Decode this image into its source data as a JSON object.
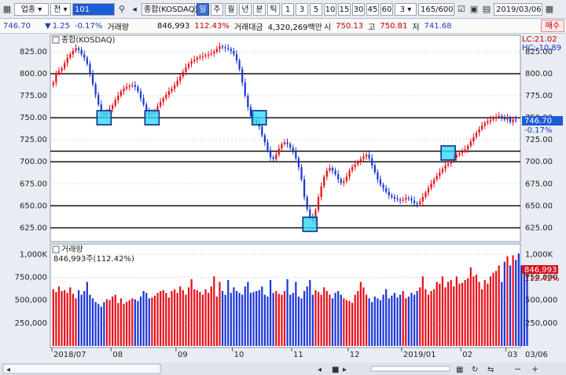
{
  "toolbar": {
    "sector_select": "업종",
    "field_label": "전",
    "code": "101",
    "name": "종합(KOSDAQ)",
    "periods": [
      "주",
      "월",
      "년",
      "분",
      "틱"
    ],
    "minute_steps": [
      "1",
      "3",
      "5",
      "10",
      "15",
      "30",
      "45",
      "60"
    ],
    "interval_value": "3",
    "count_display": "165/600",
    "date": "2019/03/06"
  },
  "quote": {
    "price": "746.70",
    "change": "1.25",
    "change_pct": "-0.17%",
    "volume_label": "거래량",
    "volume": "846,993",
    "volume_pct": "112.43%",
    "amount_label": "거래대금",
    "amount": "4,320,269백만",
    "open_label": "시",
    "open": "750.13",
    "high_label": "고",
    "high": "750.81",
    "low_label": "저",
    "low": "741.68",
    "buy_button": "매수"
  },
  "price_panel": {
    "title": "종합(KOSDAQ)",
    "lc": "LC:21.02",
    "hc": "HC:-10.89",
    "last_label": "746.70",
    "last_change": "-0.17%",
    "y_ticks": [
      825,
      800,
      775,
      750,
      725,
      700,
      675,
      650,
      625
    ],
    "y_tick_labels": [
      "825.00",
      "800.00",
      "775.00",
      "750.00",
      "725.00",
      "700.00",
      "675.00",
      "650.00",
      "625.00"
    ],
    "support_resistance_levels": [
      800,
      750,
      712,
      700,
      650,
      625
    ]
  },
  "volume_panel": {
    "title": "거래량",
    "subtitle": "846,993주(112.42%)",
    "y_ticks": [
      1000,
      750,
      500,
      250
    ],
    "y_tick_labels": [
      "1,000K",
      "750,000",
      "500,000",
      "250,000"
    ],
    "last_label": "846,993",
    "last_pct": "112.42%"
  },
  "x_axis": {
    "labels": [
      "2018/07",
      "08",
      "09",
      "10",
      "11",
      "12",
      "2019/01",
      "02",
      "03"
    ],
    "right_label": "03/06"
  },
  "colors": {
    "up": "#e8101a",
    "down": "#1c37d8",
    "highlight_fill": "#34d9f4",
    "highlight_stroke": "#0d2f86",
    "last_price_bg": "#1c5bd6",
    "last_volume_bg": "#d8101a"
  },
  "chart_data": {
    "type": "candlestick",
    "price_closes": [
      790,
      800,
      803,
      806,
      812,
      818,
      822,
      826,
      829,
      827,
      822,
      818,
      811,
      800,
      788,
      776,
      765,
      755,
      752,
      756,
      760,
      764,
      770,
      775,
      780,
      783,
      785,
      786,
      787,
      785,
      780,
      772,
      765,
      758,
      753,
      755,
      758,
      763,
      768,
      772,
      776,
      780,
      783,
      787,
      792,
      797,
      802,
      807,
      811,
      814,
      816,
      818,
      819,
      820,
      821,
      822,
      823,
      825,
      828,
      831,
      830,
      829,
      828,
      826,
      822,
      815,
      805,
      790,
      775,
      762,
      752,
      748,
      744,
      740,
      730,
      722,
      713,
      705,
      703,
      708,
      715,
      720,
      722,
      720,
      716,
      712,
      704,
      694,
      680,
      660,
      646,
      637,
      632,
      645,
      660,
      672,
      683,
      690,
      693,
      690,
      686,
      680,
      676,
      678,
      683,
      690,
      694,
      697,
      700,
      703,
      706,
      708,
      704,
      696,
      688,
      680,
      674,
      670,
      666,
      662,
      660,
      658,
      657,
      656,
      657,
      659,
      658,
      656,
      653,
      652,
      655,
      660,
      665,
      670,
      675,
      680,
      684,
      688,
      692,
      696,
      698,
      701,
      705,
      708,
      710,
      712,
      714,
      718,
      723,
      728,
      733,
      737,
      741,
      744,
      746,
      748,
      750,
      751,
      752,
      750,
      748,
      750,
      745,
      748,
      746.7
    ],
    "highlight_boxes": [
      {
        "index": 18,
        "price": 750
      },
      {
        "index": 35,
        "price": 750
      },
      {
        "index": 73,
        "price": 750
      },
      {
        "index": 91,
        "price": 629
      },
      {
        "index": 140,
        "price": 710
      }
    ],
    "volume_thousands": [
      620,
      590,
      650,
      600,
      610,
      580,
      640,
      570,
      520,
      610,
      560,
      600,
      700,
      560,
      520,
      480,
      460,
      430,
      480,
      510,
      500,
      540,
      560,
      470,
      520,
      460,
      480,
      500,
      520,
      510,
      490,
      540,
      600,
      580,
      520,
      530,
      550,
      580,
      600,
      610,
      580,
      530,
      600,
      620,
      580,
      650,
      610,
      560,
      640,
      730,
      620,
      610,
      590,
      560,
      620,
      580,
      650,
      760,
      540,
      700,
      600,
      560,
      720,
      580,
      640,
      600,
      580,
      560,
      650,
      700,
      580,
      590,
      600,
      610,
      650,
      560,
      540,
      720,
      580,
      600,
      570,
      560,
      600,
      730,
      560,
      580,
      700,
      540,
      520,
      600,
      650,
      720,
      560,
      610,
      590,
      560,
      640,
      600,
      560,
      520,
      580,
      600,
      560,
      520,
      500,
      490,
      470,
      560,
      600,
      700,
      640,
      560,
      520,
      480,
      540,
      520,
      500,
      560,
      620,
      520,
      550,
      580,
      530,
      560,
      600,
      520,
      540,
      580,
      560,
      600,
      640,
      760,
      620,
      560,
      600,
      620,
      700,
      680,
      760,
      640,
      700,
      720,
      650,
      760,
      680,
      690,
      720,
      740,
      860,
      760,
      780,
      700,
      620,
      720,
      680,
      760,
      800,
      820,
      880,
      700,
      920,
      980,
      880,
      990,
      940,
      1010,
      880,
      800,
      847
    ]
  }
}
